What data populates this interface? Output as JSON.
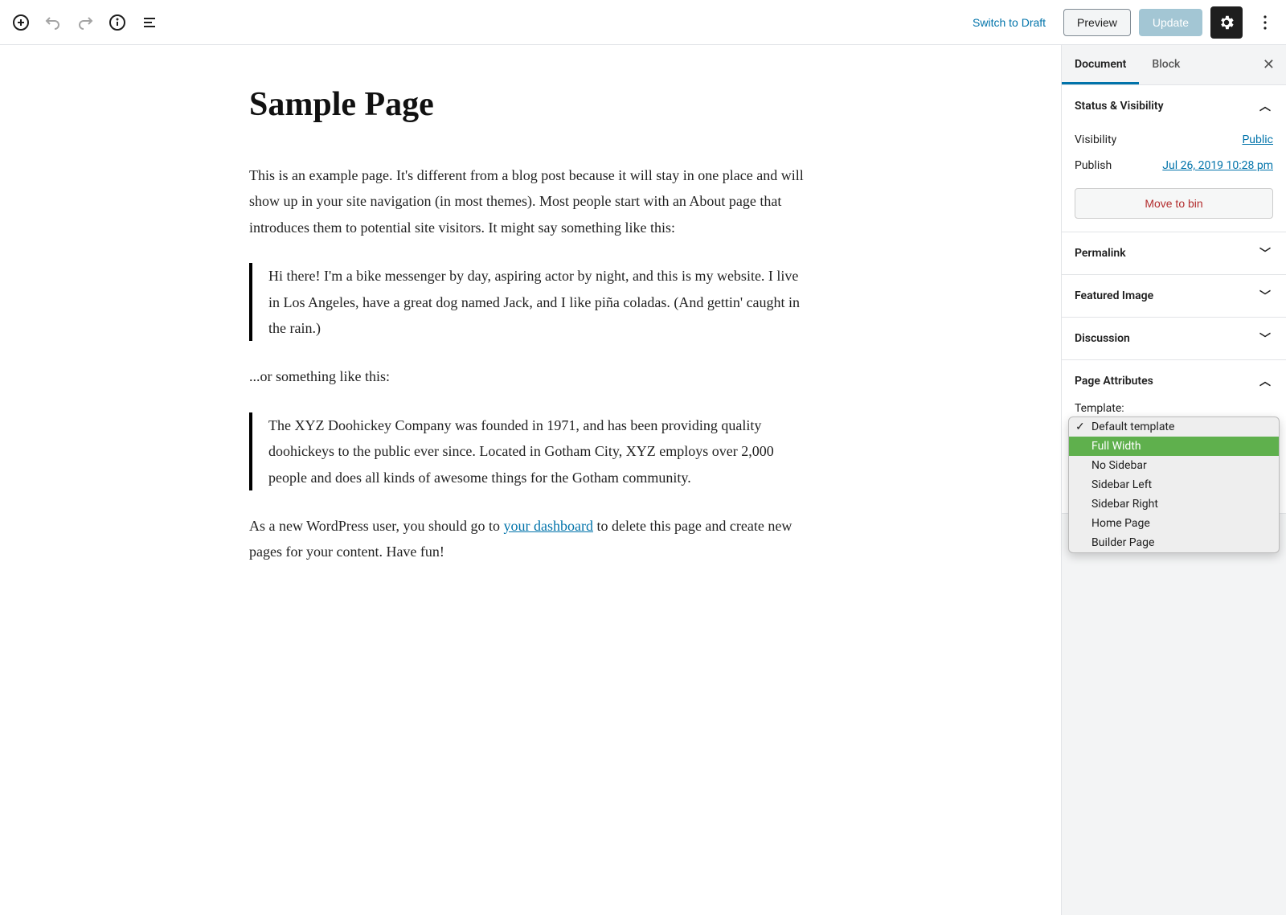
{
  "toolbar": {
    "switch_draft": "Switch to Draft",
    "preview": "Preview",
    "update": "Update"
  },
  "sidebar": {
    "tabs": {
      "document": "Document",
      "block": "Block"
    },
    "panels": {
      "status": {
        "title": "Status & Visibility",
        "visibility_label": "Visibility",
        "visibility_value": "Public",
        "publish_label": "Publish",
        "publish_value": "Jul 26, 2019 10:28 pm",
        "move_to_bin": "Move to bin"
      },
      "permalink": "Permalink",
      "featured_image": "Featured Image",
      "discussion": "Discussion",
      "page_attributes": {
        "title": "Page Attributes",
        "template_label": "Template:",
        "options": [
          "Default template",
          "Full Width",
          "No Sidebar",
          "Sidebar Left",
          "Sidebar Right",
          "Home Page",
          "Builder Page"
        ],
        "selected": "Default template",
        "highlighted": "Full Width"
      }
    }
  },
  "editor": {
    "title": "Sample Page",
    "p1": "This is an example page. It's different from a blog post because it will stay in one place and will show up in your site navigation (in most themes). Most people start with an About page that introduces them to potential site visitors. It might say something like this:",
    "quote1": "Hi there! I'm a bike messenger by day, aspiring actor by night, and this is my website. I live in Los Angeles, have a great dog named Jack, and I like piña coladas. (And gettin' caught in the rain.)",
    "p2": "...or something like this:",
    "quote2": "The XYZ Doohickey Company was founded in 1971, and has been providing quality doohickeys to the public ever since. Located in Gotham City, XYZ employs over 2,000 people and does all kinds of awesome things for the Gotham community.",
    "p3_before": "As a new WordPress user, you should go to ",
    "p3_link": "your dashboard",
    "p3_after": " to delete this page and create new pages for your content. Have fun!"
  }
}
